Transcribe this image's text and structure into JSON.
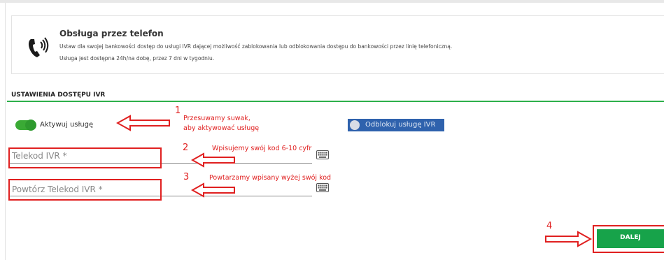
{
  "phone_service": {
    "title": "Obsługa przez telefon",
    "description": "Ustaw dla swojej bankowości dostęp do usługi IVR dającej możliwość zablokowania lub odblokowania dostępu do bankowości przez linię telefoniczną.",
    "availability": "Usługa jest dostępna 24h/na dobę, przez 7 dni w tygodniu.",
    "icon": "phone-ringing-icon"
  },
  "ivr_settings": {
    "title": "USTAWIENIA DOSTĘPU IVR",
    "activate_toggle_label": "Aktywuj usługę",
    "activate_toggle_state": "on",
    "unlock_button_label": "Odblokuj usługę IVR",
    "telecode_label": "Telekod IVR *",
    "telecode_repeat_label": "Powtórz Telekod IVR *",
    "keyboard_icon": "keyboard-icon"
  },
  "annotations": [
    {
      "number": "1",
      "text_line1": "Przesuwamy suwak,",
      "text_line2": "aby aktywować usługę"
    },
    {
      "number": "2",
      "text_line1": "Wpisujemy swój kod 6-10 cyfr"
    },
    {
      "number": "3",
      "text_line1": "Powtarzamy wpisany wyżej swój kod"
    },
    {
      "number": "4"
    }
  ],
  "actions": {
    "next_label": "DALEJ"
  },
  "colors": {
    "accent_green": "#2db04b",
    "button_green": "#17a34a",
    "unlock_blue": "#2f62ad",
    "annotation_red": "#e02020"
  }
}
